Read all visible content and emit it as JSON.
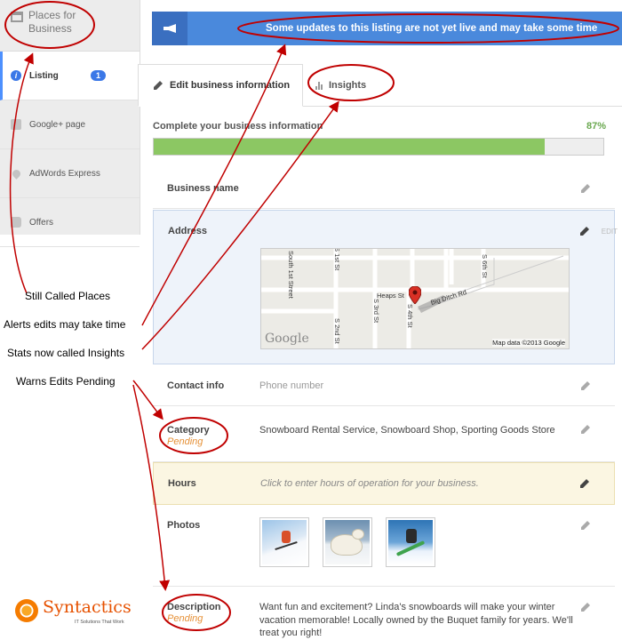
{
  "sidebar": {
    "title": "Places for Business",
    "items": [
      {
        "label": "Listing",
        "badge": "1"
      },
      {
        "label": "Google+ page"
      },
      {
        "label": "AdWords Express"
      },
      {
        "label": "Offers"
      }
    ]
  },
  "alert": {
    "message": "Some updates to this listing are not yet live and may take some time"
  },
  "tabs": [
    {
      "label": "Edit business information"
    },
    {
      "label": "Insights"
    }
  ],
  "progress": {
    "label": "Complete your business information",
    "percent_text": "87%",
    "value": 0.87
  },
  "rows": {
    "business_name": {
      "label": "Business name"
    },
    "address": {
      "label": "Address",
      "edit_text": "EDIT",
      "map": {
        "streets": [
          "South 1st Street",
          "S 1st St",
          "S 2nd St",
          "S 3rd St",
          "S 4th St",
          "S 6th St",
          "Heaps St",
          "Big Ditch Rd"
        ],
        "logo": "Google",
        "copyright": "Map data ©2013 Google"
      }
    },
    "contact": {
      "label": "Contact info",
      "value": "Phone number"
    },
    "category": {
      "label": "Category",
      "status": "Pending",
      "value": "Snowboard Rental Service, Snowboard Shop, Sporting Goods Store"
    },
    "hours": {
      "label": "Hours",
      "value": "Click to enter hours of operation for your business."
    },
    "photos": {
      "label": "Photos"
    },
    "description": {
      "label": "Description",
      "status": "Pending",
      "value": "Want fun and excitement? Linda's snowboards will make your winter vacation memorable! Locally owned by the Buquet family for years. We'll treat you right!"
    }
  },
  "annotations": {
    "places": "Still Called Places",
    "alerts": "Alerts edits may take time",
    "insights": "Stats now called Insights",
    "pending": "Warns Edits Pending"
  },
  "brand": {
    "name": "Syntactics",
    "tagline": "IT Solutions That Work"
  },
  "colors": {
    "accent": "#4a89dc",
    "progress": "#8cc763",
    "pending": "#e69138",
    "annotation": "#c00000"
  }
}
